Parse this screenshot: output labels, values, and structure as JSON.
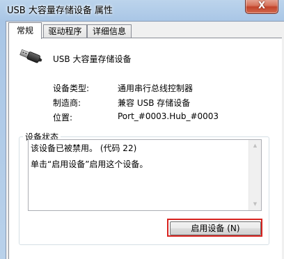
{
  "window": {
    "title": "USB 大容量存储设备 属性",
    "close_label": "X"
  },
  "tabs": [
    {
      "label": "常规",
      "active": true
    },
    {
      "label": "驱动程序",
      "active": false
    },
    {
      "label": "详细信息",
      "active": false
    }
  ],
  "device": {
    "name": "USB 大容量存储设备",
    "icon": "usb-plug-icon"
  },
  "properties": [
    {
      "label": "设备类型:",
      "value": "通用串行总线控制器"
    },
    {
      "label": "制造商:",
      "value": "兼容 USB 存储设备"
    },
    {
      "label": "位置:",
      "value": "Port_#0003.Hub_#0003"
    }
  ],
  "device_status": {
    "group_title": "设备状态",
    "lines": [
      "该设备已被禁用。 (代码 22)",
      "单击“启用设备”启用这个设备。"
    ]
  },
  "buttons": {
    "enable_device": "启用设备 (N)"
  },
  "colors": {
    "highlight_border": "#d8231f",
    "close_button": "#c2432a",
    "titlebar": "#a9c6e6"
  }
}
